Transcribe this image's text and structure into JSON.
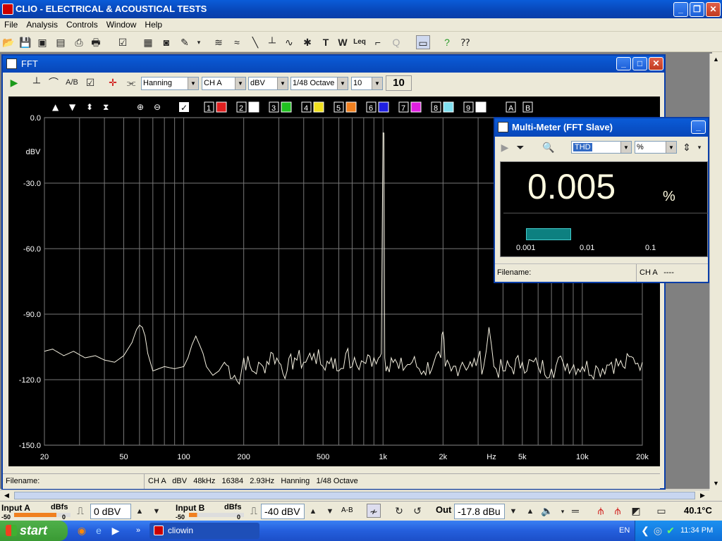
{
  "app": {
    "title": "CLIO - ELECTRICAL & ACOUSTICAL TESTS"
  },
  "menu": [
    "File",
    "Analysis",
    "Controls",
    "Window",
    "Help"
  ],
  "fft": {
    "title": "FFT",
    "window": "Hanning",
    "channel": "CH A",
    "unit": "dBV",
    "smoothing": "1/48 Octave",
    "avg": "10",
    "avg_display": "10",
    "channel_buttons": [
      "1",
      "2",
      "3",
      "4",
      "5",
      "6",
      "7",
      "8",
      "9",
      "A",
      "B"
    ],
    "status": {
      "filename_label": "Filename:",
      "info": "CH A   dBV   48kHz   16384   2.93Hz   Hanning   1/48 Octave"
    }
  },
  "chart_data": {
    "type": "line",
    "ylabel": "dBV",
    "xlabel": "Hz",
    "xscale": "log",
    "xlim": [
      20,
      20000
    ],
    "ylim": [
      -150,
      0
    ],
    "yticks": [
      "0.0",
      "-30.0",
      "-60.0",
      "-90.0",
      "-120.0",
      "-150.0"
    ],
    "xticks": [
      "20",
      "50",
      "100",
      "200",
      "500",
      "1k",
      "2k",
      "Hz",
      "5k",
      "10k",
      "20k"
    ],
    "grid": true,
    "x": [
      20,
      22,
      25,
      28,
      32,
      36,
      40,
      45,
      50,
      55,
      58,
      60,
      62,
      64,
      66,
      70,
      80,
      90,
      100,
      105,
      110,
      115,
      120,
      125,
      130,
      140,
      150,
      160,
      180,
      190,
      200,
      220,
      250,
      280,
      300,
      330,
      360,
      400,
      450,
      500,
      550,
      600,
      650,
      700,
      800,
      900,
      950,
      980,
      1000,
      1010,
      1020,
      1050,
      1100,
      1200,
      1400,
      1600,
      1800,
      1950,
      2000,
      2050,
      2200,
      2500,
      2800,
      3000,
      3200,
      3400,
      3600,
      4000,
      5000,
      6000,
      7000,
      8000,
      10000,
      12000,
      14000,
      16000,
      18000,
      20000
    ],
    "y": [
      -107,
      -106,
      -109,
      -107,
      -110,
      -109,
      -111,
      -112,
      -109,
      -103,
      -97,
      -95,
      -96,
      -100,
      -108,
      -116,
      -114,
      -115,
      -114,
      -110,
      -104,
      -100,
      -104,
      -108,
      -114,
      -118,
      -116,
      -112,
      -118,
      -122,
      -110,
      -116,
      -114,
      -108,
      -112,
      -116,
      -110,
      -112,
      -108,
      -114,
      -110,
      -116,
      -108,
      -114,
      -112,
      -110,
      -110,
      -108,
      -7,
      -7,
      -110,
      -114,
      -110,
      -115,
      -112,
      -116,
      -112,
      -110,
      -98,
      -114,
      -116,
      -112,
      -114,
      -110,
      -114,
      -96,
      -114,
      -116,
      -112,
      -114,
      -115,
      -112,
      -114,
      -115,
      -112,
      -114,
      -110,
      -112
    ]
  },
  "multimeter": {
    "title": "Multi-Meter (FFT Slave)",
    "parameter": "THD",
    "unit_select": "%",
    "value": "0.005",
    "unit": "%",
    "bar_fraction": 0.22,
    "scale": [
      "0.001",
      "0.01",
      "0.1"
    ],
    "filename_label": "Filename:",
    "channel_info": "CH A   ----"
  },
  "bottom": {
    "input_a_label": "Input A",
    "input_a_unit": "dBfs",
    "input_a_scale_low": "-50",
    "input_a_scale_high": "0",
    "input_a_value": "0 dBV",
    "input_b_label": "Input B",
    "input_b_unit": "dBfs",
    "input_b_scale_low": "-50",
    "input_b_scale_high": "0",
    "input_b_value": "-40 dBV",
    "ab_label": "A-B",
    "out_label": "Out",
    "out_value": "-17.8 dBu",
    "temperature": "40.1°C"
  },
  "taskbar": {
    "start": "start",
    "task": "cliowin",
    "lang": "EN",
    "clock": "11:34 PM"
  }
}
